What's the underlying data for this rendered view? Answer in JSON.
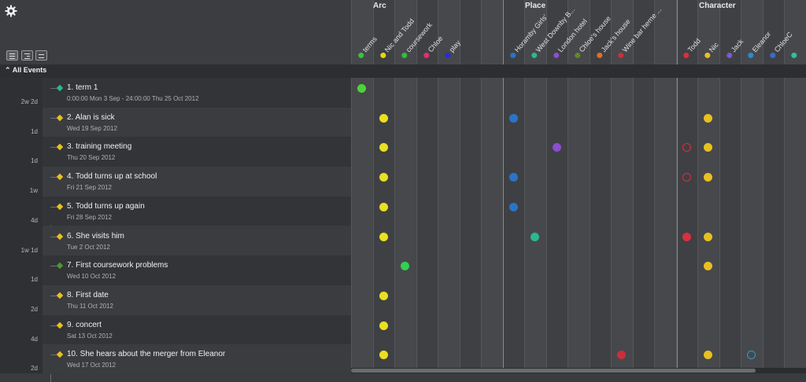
{
  "groups": [
    {
      "label": "Arc"
    },
    {
      "label": "Place"
    },
    {
      "label": "Character"
    }
  ],
  "columns": [
    {
      "label": "terms",
      "color": "#39c43c"
    },
    {
      "label": "Nic and Todd",
      "color": "#e8d800"
    },
    {
      "label": "coursework",
      "color": "#2fbf3a"
    },
    {
      "label": "Chloe",
      "color": "#e0306a"
    },
    {
      "label": "play",
      "color": "#2a2ad8"
    },
    {
      "label": "",
      "color": ""
    },
    {
      "label": "",
      "color": ""
    },
    {
      "label": "Horamby Girls'",
      "color": "#2a74c8"
    },
    {
      "label": "West Downby B...",
      "color": "#2ab890"
    },
    {
      "label": "London hotel",
      "color": "#8a4ed0"
    },
    {
      "label": "Chloe's house",
      "color": "#5c8a2a"
    },
    {
      "label": "Jack's house",
      "color": "#e07020"
    },
    {
      "label": "Wine bar herne ...",
      "color": "#c8303a"
    },
    {
      "label": "",
      "color": ""
    },
    {
      "label": "",
      "color": ""
    },
    {
      "label": "Todd",
      "color": "#d83040"
    },
    {
      "label": "Nic",
      "color": "#e8c020"
    },
    {
      "label": "Jack",
      "color": "#7a5ad0"
    },
    {
      "label": "Eleanor",
      "color": "#2a8ad0"
    },
    {
      "label": "ChloeC",
      "color": "#3a6ad0"
    },
    {
      "label": "",
      "color": "#30c0a0"
    }
  ],
  "toolbar": {
    "all_events_label": "All Events",
    "settings_icon": "gear-icon",
    "view_buttons": [
      "list-view-icon",
      "detail-view-icon",
      "grid-view-icon"
    ]
  },
  "gaps": [
    "2w 2d",
    "1d",
    "1d",
    "1w",
    "4d",
    "1w 1d",
    "1d",
    "2d",
    "4d",
    "2d"
  ],
  "events": [
    {
      "title": "1. term 1",
      "date": "0:00:00 Mon 3 Sep - 24:00:00 Thu 25 Oct 2012",
      "diamond": "#2ab890",
      "marks": [
        {
          "col": 0,
          "color": "#4cd438",
          "filled": true
        }
      ]
    },
    {
      "title": "2. Alan is sick",
      "date": "Wed 19 Sep 2012",
      "diamond": "#e8c020",
      "marks": [
        {
          "col": 1,
          "color": "#e8e020",
          "filled": true
        },
        {
          "col": 7,
          "color": "#2a74c8",
          "filled": true
        },
        {
          "col": 16,
          "color": "#e8c020",
          "filled": true
        }
      ]
    },
    {
      "title": "3. training meeting",
      "date": "Thu 20 Sep 2012",
      "diamond": "#e8c020",
      "marks": [
        {
          "col": 1,
          "color": "#e8e020",
          "filled": true
        },
        {
          "col": 9,
          "color": "#8a4ed0",
          "filled": true
        },
        {
          "col": 15,
          "color": "#d83040",
          "filled": false
        },
        {
          "col": 16,
          "color": "#e8c020",
          "filled": true
        }
      ]
    },
    {
      "title": "4. Todd turns up at school",
      "date": "Fri 21 Sep 2012",
      "diamond": "#e8c020",
      "marks": [
        {
          "col": 1,
          "color": "#e8e020",
          "filled": true
        },
        {
          "col": 7,
          "color": "#2a74c8",
          "filled": true
        },
        {
          "col": 15,
          "color": "#d83040",
          "filled": false
        },
        {
          "col": 16,
          "color": "#e8c020",
          "filled": true
        }
      ]
    },
    {
      "title": "5. Todd turns up again",
      "date": "Fri 28 Sep 2012",
      "diamond": "#e8c020",
      "marks": [
        {
          "col": 1,
          "color": "#e8e020",
          "filled": true
        },
        {
          "col": 7,
          "color": "#2a74c8",
          "filled": true
        }
      ]
    },
    {
      "title": "6. She visits him",
      "date": "Tue 2 Oct 2012",
      "diamond": "#e8c020",
      "marks": [
        {
          "col": 1,
          "color": "#e8e020",
          "filled": true
        },
        {
          "col": 8,
          "color": "#2ab890",
          "filled": true
        },
        {
          "col": 15,
          "color": "#d83040",
          "filled": true
        },
        {
          "col": 16,
          "color": "#e8c020",
          "filled": true
        }
      ]
    },
    {
      "title": "7. First coursework problems",
      "date": "Wed 10 Oct 2012",
      "diamond": "#4a9a2a",
      "marks": [
        {
          "col": 2,
          "color": "#30d050",
          "filled": true
        },
        {
          "col": 16,
          "color": "#e8c020",
          "filled": true
        }
      ]
    },
    {
      "title": "8. First date",
      "date": "Thu 11 Oct 2012",
      "diamond": "#e8c020",
      "marks": [
        {
          "col": 1,
          "color": "#e8e020",
          "filled": true
        }
      ]
    },
    {
      "title": "9. concert",
      "date": "Sat 13 Oct 2012",
      "diamond": "#e8c020",
      "marks": [
        {
          "col": 1,
          "color": "#e8e020",
          "filled": true
        }
      ]
    },
    {
      "title": "10. She hears about the merger from Eleanor",
      "date": "Wed 17 Oct 2012",
      "diamond": "#e8c020",
      "marks": [
        {
          "col": 1,
          "color": "#e8e020",
          "filled": true
        },
        {
          "col": 12,
          "color": "#c8303a",
          "filled": true
        },
        {
          "col": 16,
          "color": "#e8c020",
          "filled": true
        },
        {
          "col": 18,
          "color": "#2a9ad0",
          "filled": false
        }
      ]
    }
  ]
}
